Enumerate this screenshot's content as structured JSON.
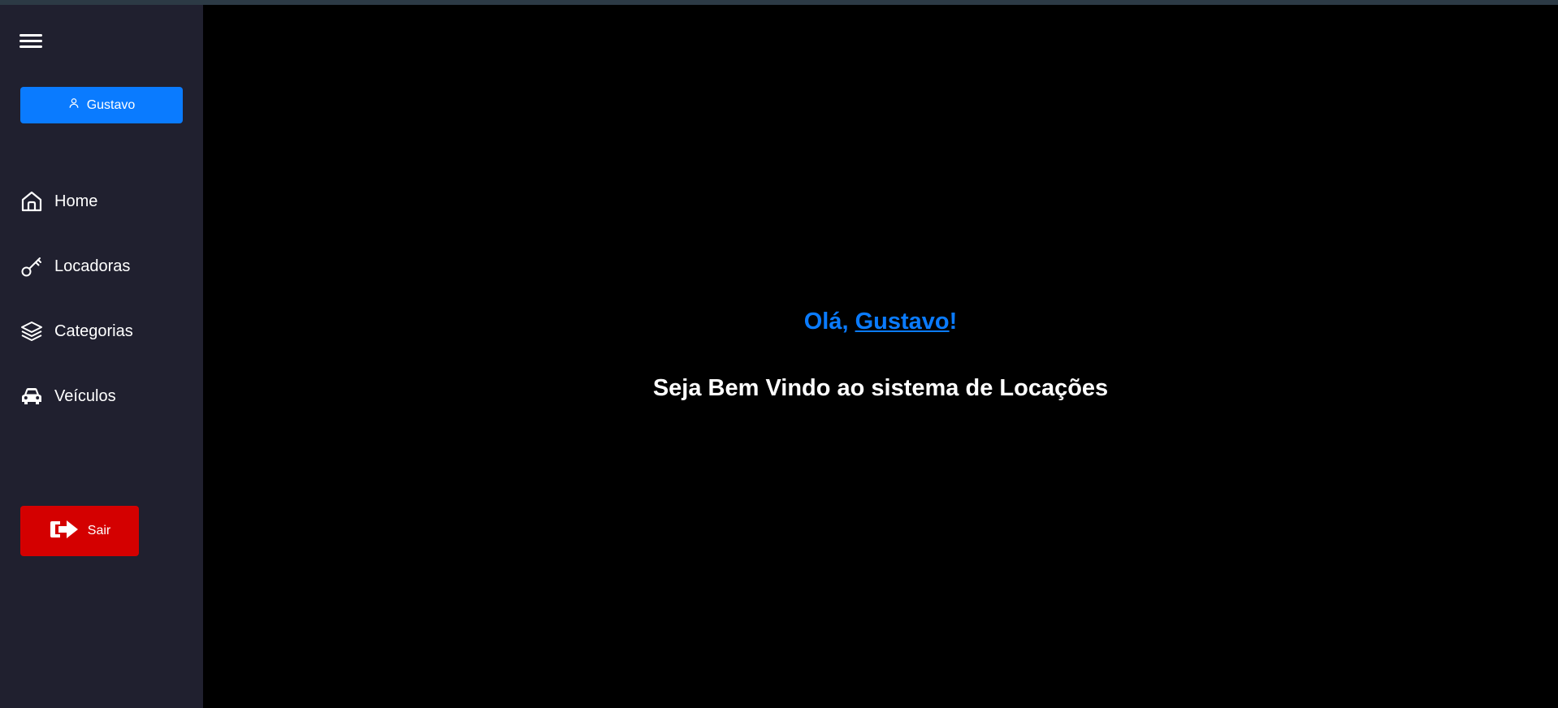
{
  "sidebar": {
    "menu_icon": "hamburger-menu-icon",
    "user_button": {
      "label": "Gustavo",
      "icon": "user-icon",
      "color": "#0a7bff"
    },
    "nav_items": [
      {
        "label": "Home",
        "icon": "home-icon"
      },
      {
        "label": "Locadoras",
        "icon": "key-icon"
      },
      {
        "label": "Categorias",
        "icon": "layers-icon"
      },
      {
        "label": "Veículos",
        "icon": "car-icon"
      }
    ],
    "logout_button": {
      "label": "Sair",
      "icon": "logout-icon",
      "color": "#d40000"
    },
    "background": "#20202f"
  },
  "main": {
    "greeting_prefix": "Olá, ",
    "greeting_name": "Gustavo",
    "greeting_suffix": "!",
    "subtitle": "Seja Bem Vindo ao sistema de Locações",
    "accent_color": "#0a7bff",
    "background": "#000000"
  }
}
